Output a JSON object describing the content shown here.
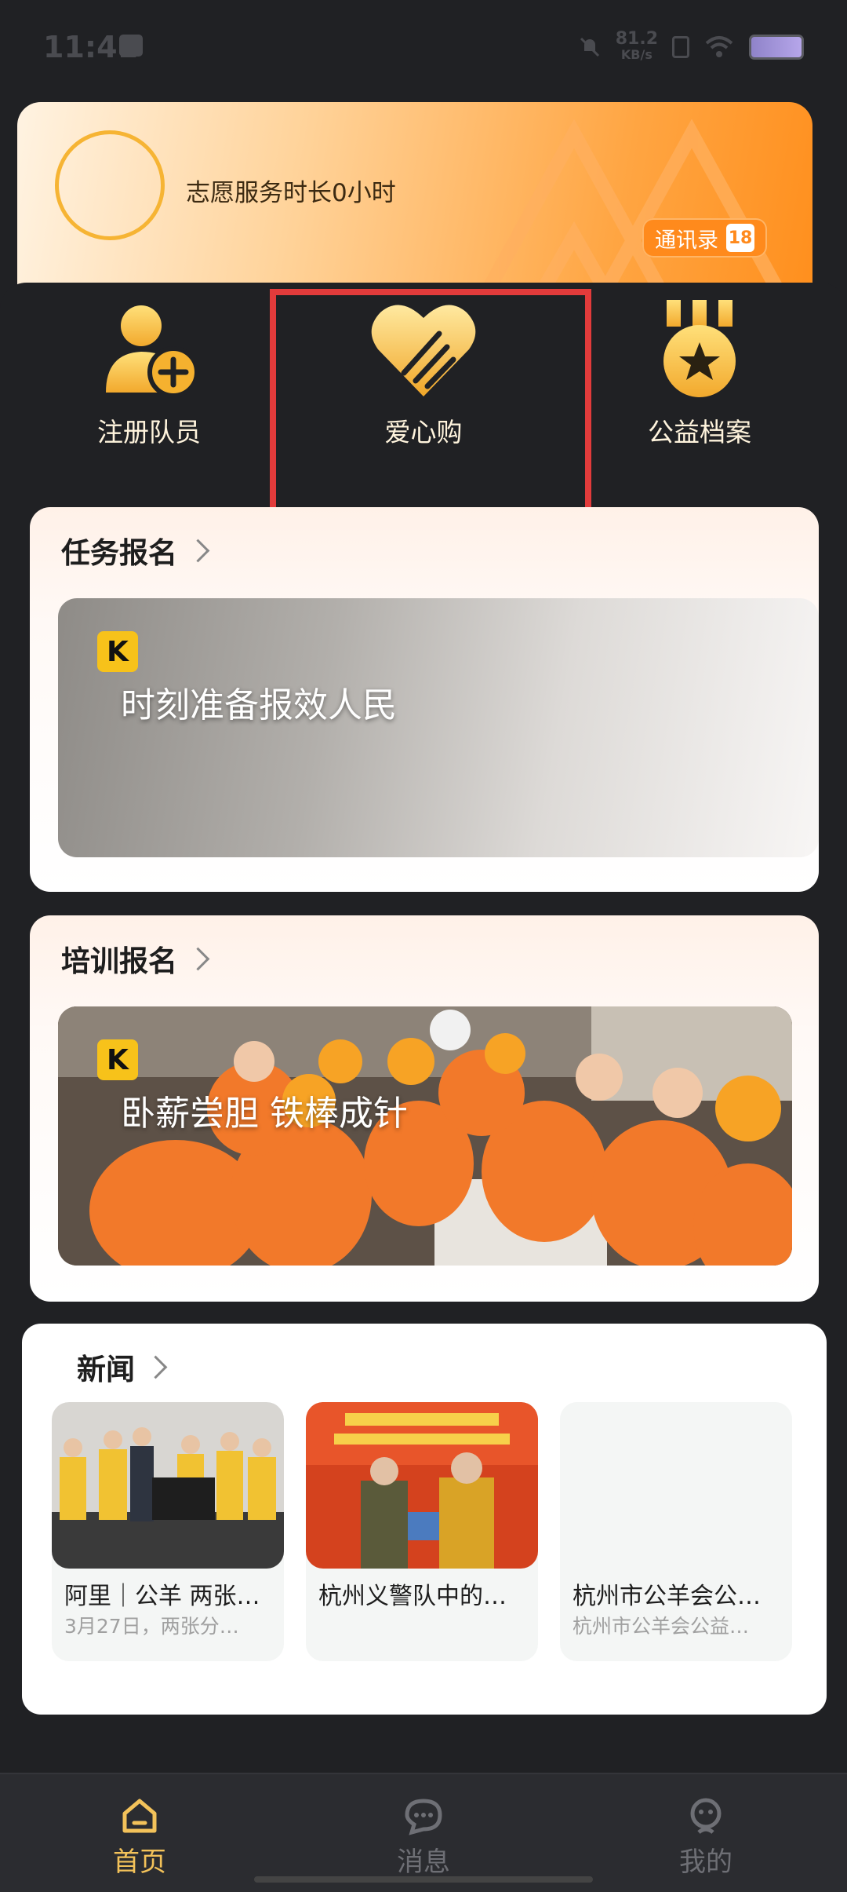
{
  "status_bar": {
    "time": "11:41",
    "net_speed": "81.2",
    "net_unit": "KB/s"
  },
  "banner": {
    "volunteer_text": "志愿服务时长0小时",
    "contacts_label": "通讯录",
    "contacts_icon": "18"
  },
  "quick_actions": [
    {
      "label": "注册队员",
      "icon": "add-user-icon"
    },
    {
      "label": "爱心购",
      "icon": "heart-handshake-icon"
    },
    {
      "label": "公益档案",
      "icon": "medal-icon"
    }
  ],
  "task_section": {
    "title": "任务报名",
    "banner_text": "时刻准备报效人民",
    "logo": "K"
  },
  "training_section": {
    "title": "培训报名",
    "banner_text": "卧薪尝胆 铁棒成针",
    "logo": "K"
  },
  "news_section": {
    "title": "新闻",
    "items": [
      {
        "title": "阿里｜公羊 两张…",
        "subtitle": "3月27日，两张分…"
      },
      {
        "title": "杭州义警队中的…",
        "subtitle": ""
      },
      {
        "title": "杭州市公羊会公…",
        "subtitle": "杭州市公羊会公益…"
      }
    ]
  },
  "bottom_nav": [
    {
      "label": "首页",
      "active": true,
      "icon": "home-icon"
    },
    {
      "label": "消息",
      "active": false,
      "icon": "chat-icon"
    },
    {
      "label": "我的",
      "active": false,
      "icon": "profile-icon"
    }
  ],
  "colors": {
    "accent": "#f6b434",
    "nav_active": "#f3c25a",
    "nav_inactive": "#6e6f75",
    "highlight": "#e23b3b"
  }
}
